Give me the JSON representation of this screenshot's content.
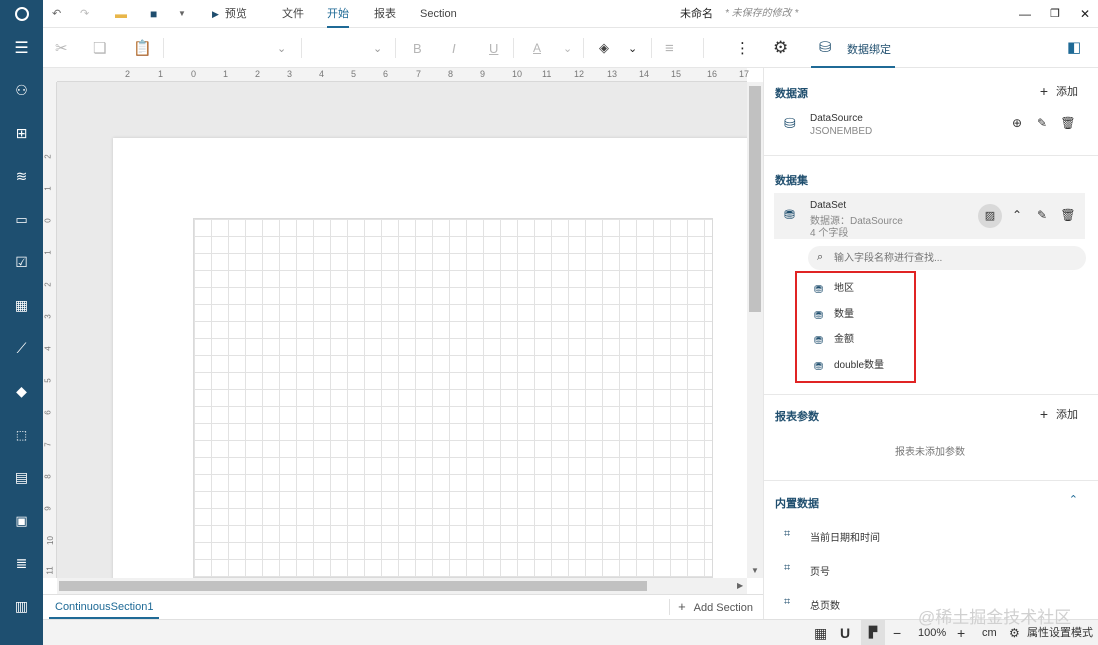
{
  "titlebar": {
    "preview_label": "预览",
    "menu": [
      "文件",
      "开始",
      "报表",
      "Section"
    ],
    "active_menu": "开始",
    "doc_name": "未命名",
    "unsaved": "* 未保存的修改 *"
  },
  "toolbar": {
    "panel_tab_label": "数据绑定",
    "bold": "B",
    "italic": "I",
    "underline": "U",
    "font_color": "A"
  },
  "ruler": {
    "h_ticks": [
      "2",
      "1",
      "0",
      "1",
      "2",
      "3",
      "4",
      "5",
      "6",
      "7",
      "8",
      "9",
      "10",
      "11",
      "12",
      "13",
      "14",
      "15",
      "16",
      "17"
    ],
    "v_ticks": [
      "2",
      "1",
      "0",
      "1",
      "2",
      "3",
      "4",
      "5",
      "6",
      "7",
      "8",
      "9",
      "10",
      "11"
    ]
  },
  "section": {
    "tab_label": "ContinuousSection1",
    "add_label": "Add Section"
  },
  "status": {
    "zoom": "100%",
    "unit": "cm",
    "mode_label": "属性设置模式"
  },
  "panel": {
    "datasource_title": "数据源",
    "add_label": "添加",
    "datasource": {
      "name": "DataSource",
      "type": "JSONEMBED"
    },
    "dataset_title": "数据集",
    "dataset": {
      "name": "DataSet",
      "source": "数据源：DataSource",
      "fields_count": "4 个字段"
    },
    "search_placeholder": "输入字段名称进行查找...",
    "fields": [
      "地区",
      "数量",
      "金额",
      "double数量"
    ],
    "params_title": "报表参数",
    "params_empty": "报表未添加参数",
    "builtin_title": "内置数据",
    "builtin_items": [
      "当前日期和时间",
      "页号",
      "总页数"
    ]
  },
  "watermark": "@稀土掘金技术社区"
}
